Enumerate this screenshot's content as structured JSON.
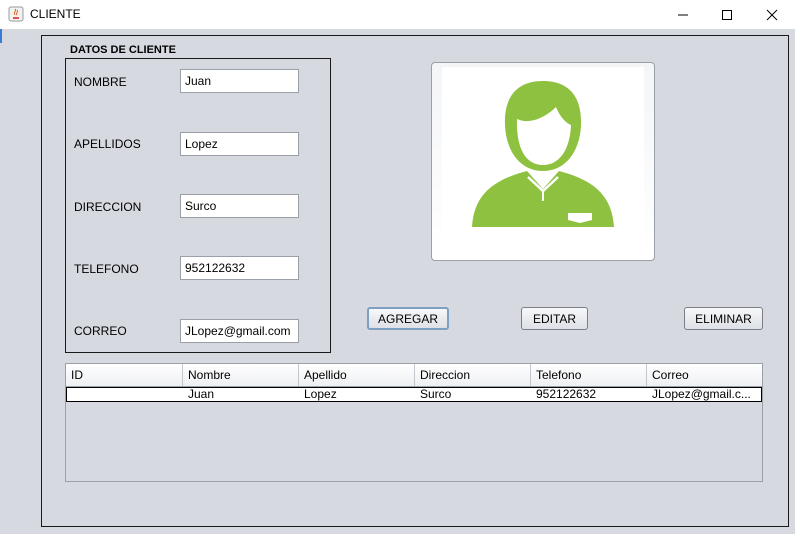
{
  "window": {
    "title": "CLIENTE"
  },
  "form": {
    "group_title": "DATOS DE CLIENTE",
    "fields": [
      {
        "label": "NOMBRE",
        "value": "Juan"
      },
      {
        "label": "APELLIDOS",
        "value": "Lopez"
      },
      {
        "label": "DIRECCION",
        "value": "Surco"
      },
      {
        "label": "TELEFONO",
        "value": "952122632"
      },
      {
        "label": "CORREO",
        "value": "JLopez@gmail.com"
      }
    ]
  },
  "photo": {
    "icon": "user-avatar-icon",
    "color": "#8dc13f"
  },
  "buttons": {
    "add": "AGREGAR",
    "edit": "EDITAR",
    "delete": "ELIMINAR"
  },
  "table": {
    "columns": [
      "ID",
      "Nombre",
      "Apellido",
      "Direccion",
      "Telefono",
      "Correo"
    ],
    "rows": [
      [
        "",
        "Juan",
        "Lopez",
        "Surco",
        "952122632",
        "JLopez@gmail.c..."
      ]
    ]
  }
}
